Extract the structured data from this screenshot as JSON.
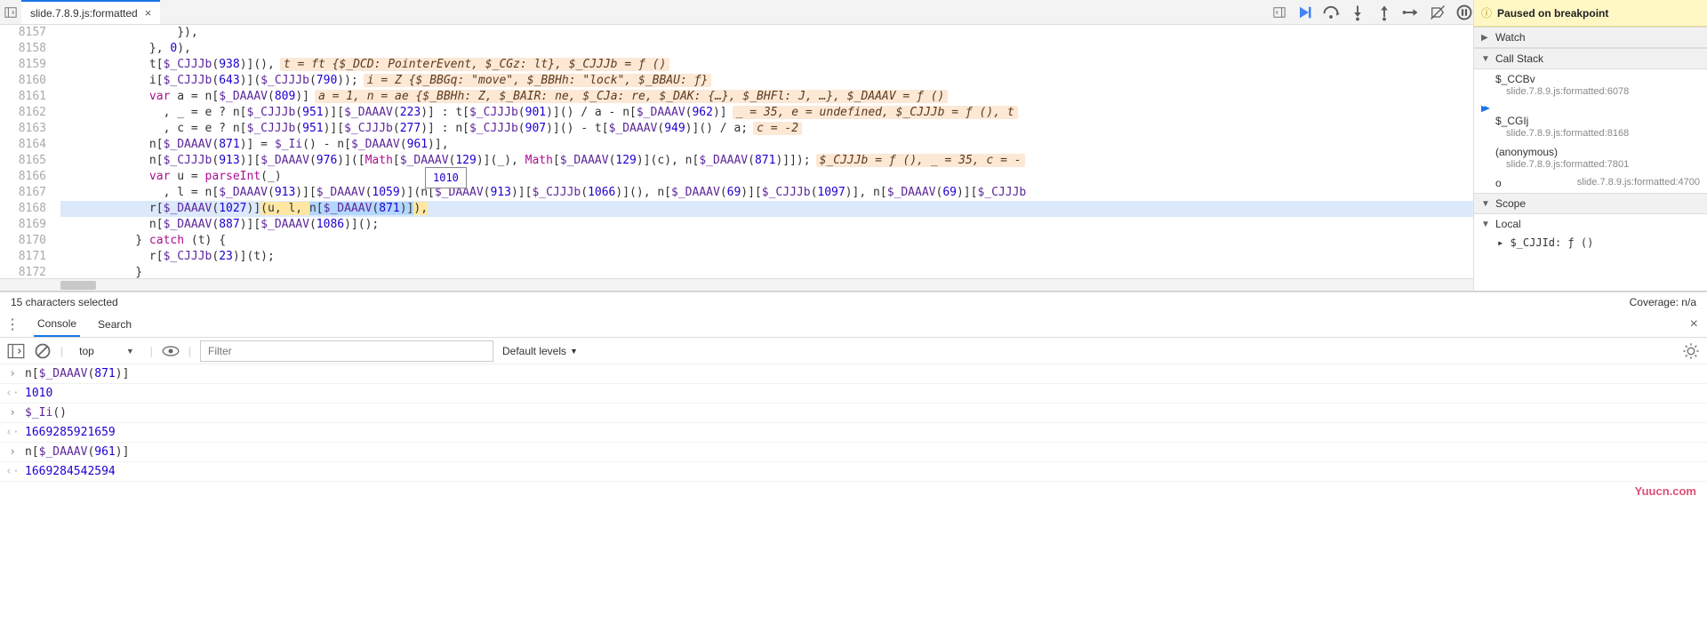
{
  "tab": {
    "title": "slide.7.8.9.js:formatted"
  },
  "editor": {
    "lines": [
      {
        "n": 8157,
        "indent": 16,
        "code": "}),",
        "hint": ""
      },
      {
        "n": 8158,
        "indent": 12,
        "code": "}, 0),",
        "hint": ""
      },
      {
        "n": 8159,
        "indent": 12,
        "code": "t[$_CJJJb(938)](),",
        "hint": "t = ft {$_DCD: PointerEvent, $_CGz: lt}, $_CJJJb = ƒ ()"
      },
      {
        "n": 8160,
        "indent": 12,
        "code": "i[$_CJJJb(643)]($_CJJJb(790));",
        "hint": "i = Z {$_BBGq: \"move\", $_BBHh: \"lock\", $_BBAU: ƒ}"
      },
      {
        "n": 8161,
        "indent": 12,
        "code": "var a = n[$_DAAAV(809)]",
        "hint": "a = 1, n = ae {$_BBHh: Z, $_BAIR: ne, $_CJa: re, $_DAK: {…}, $_BHFl: J, …}, $_DAAAV = ƒ ()"
      },
      {
        "n": 8162,
        "indent": 14,
        "code": ", _ = e ? n[$_CJJJb(951)][$_DAAAV(223)] : t[$_CJJJb(901)]() / a - n[$_DAAAV(962)]",
        "hint": "_ = 35, e = undefined, $_CJJJb = ƒ (), t"
      },
      {
        "n": 8163,
        "indent": 14,
        "code": ", c = e ? n[$_CJJJb(951)][$_CJJJb(277)] : n[$_CJJJb(907)]() - t[$_DAAAV(949)]() / a;",
        "hint": "c = -2"
      },
      {
        "n": 8164,
        "indent": 12,
        "code": "n[$_DAAAV(871)] = $_Ii() - n[$_DAAAV(961)],",
        "hint": ""
      },
      {
        "n": 8165,
        "indent": 12,
        "code": "n[$_CJJJb(913)][$_DAAAV(976)]([Math[$_DAAAV(129)](_), Math[$_DAAAV(129)](c), n[$_DAAAV(871)]]);",
        "hint": "$_CJJJb = ƒ (), _ = 35, c = -"
      },
      {
        "n": 8166,
        "indent": 12,
        "code": "var u = parseInt(_)",
        "hint": "",
        "tooltip": "1010"
      },
      {
        "n": 8167,
        "indent": 14,
        "code": ", l = n[$_DAAAV(913)][$_DAAAV(1059)](n[$_DAAAV(913)][$_CJJJb(1066)](), n[$_DAAAV(69)][$_CJJJb(1097)], n[$_DAAAV(69)][$_CJJJb",
        "hint": ""
      },
      {
        "n": 8168,
        "indent": 12,
        "code": "r[$_DAAAV(1027)](u, l, n[$_DAAAV(871)]),",
        "hint": "",
        "exec": true
      },
      {
        "n": 8169,
        "indent": 12,
        "code": "n[$_DAAAV(887)][$_DAAAV(1086)]();",
        "hint": ""
      },
      {
        "n": 8170,
        "indent": 10,
        "code": "} catch (t) {",
        "hint": ""
      },
      {
        "n": 8171,
        "indent": 12,
        "code": "r[$_CJJJb(23)](t);",
        "hint": ""
      },
      {
        "n": 8172,
        "indent": 10,
        "code": "}",
        "hint": ""
      }
    ]
  },
  "status": {
    "selection": "15 characters selected",
    "coverage": "Coverage: n/a"
  },
  "debugger": {
    "paused_msg": "Paused on breakpoint",
    "sections": {
      "watch": "Watch",
      "callstack": "Call Stack",
      "scope": "Scope",
      "local": "Local"
    },
    "stack": [
      {
        "fn": "$_CCBv",
        "src": "slide.7.8.9.js:formatted:6078",
        "current": false
      },
      {
        "fn": "$_CGIj",
        "src": "slide.7.8.9.js:formatted:8168",
        "current": true
      },
      {
        "fn": "(anonymous)",
        "src": "slide.7.8.9.js:formatted:7801",
        "current": false
      },
      {
        "fn": "o",
        "src": "slide.7.8.9.js:formatted:4700",
        "current": false,
        "inline": true
      }
    ],
    "local_preview": "▸ $_CJJId: ƒ ()"
  },
  "lower": {
    "tabs": {
      "console": "Console",
      "search": "Search"
    },
    "toolbar": {
      "context": "top",
      "filter_placeholder": "Filter",
      "levels": "Default levels"
    },
    "console": [
      {
        "type": "in",
        "text": "n[$_DAAAV(871)]"
      },
      {
        "type": "out",
        "text": "1010"
      },
      {
        "type": "in",
        "text": "$_Ii()"
      },
      {
        "type": "out",
        "text": "1669285921659"
      },
      {
        "type": "in",
        "text": "n[$_DAAAV(961)]"
      },
      {
        "type": "out",
        "text": "1669284542594"
      }
    ]
  },
  "watermark": "Yuucn.com"
}
